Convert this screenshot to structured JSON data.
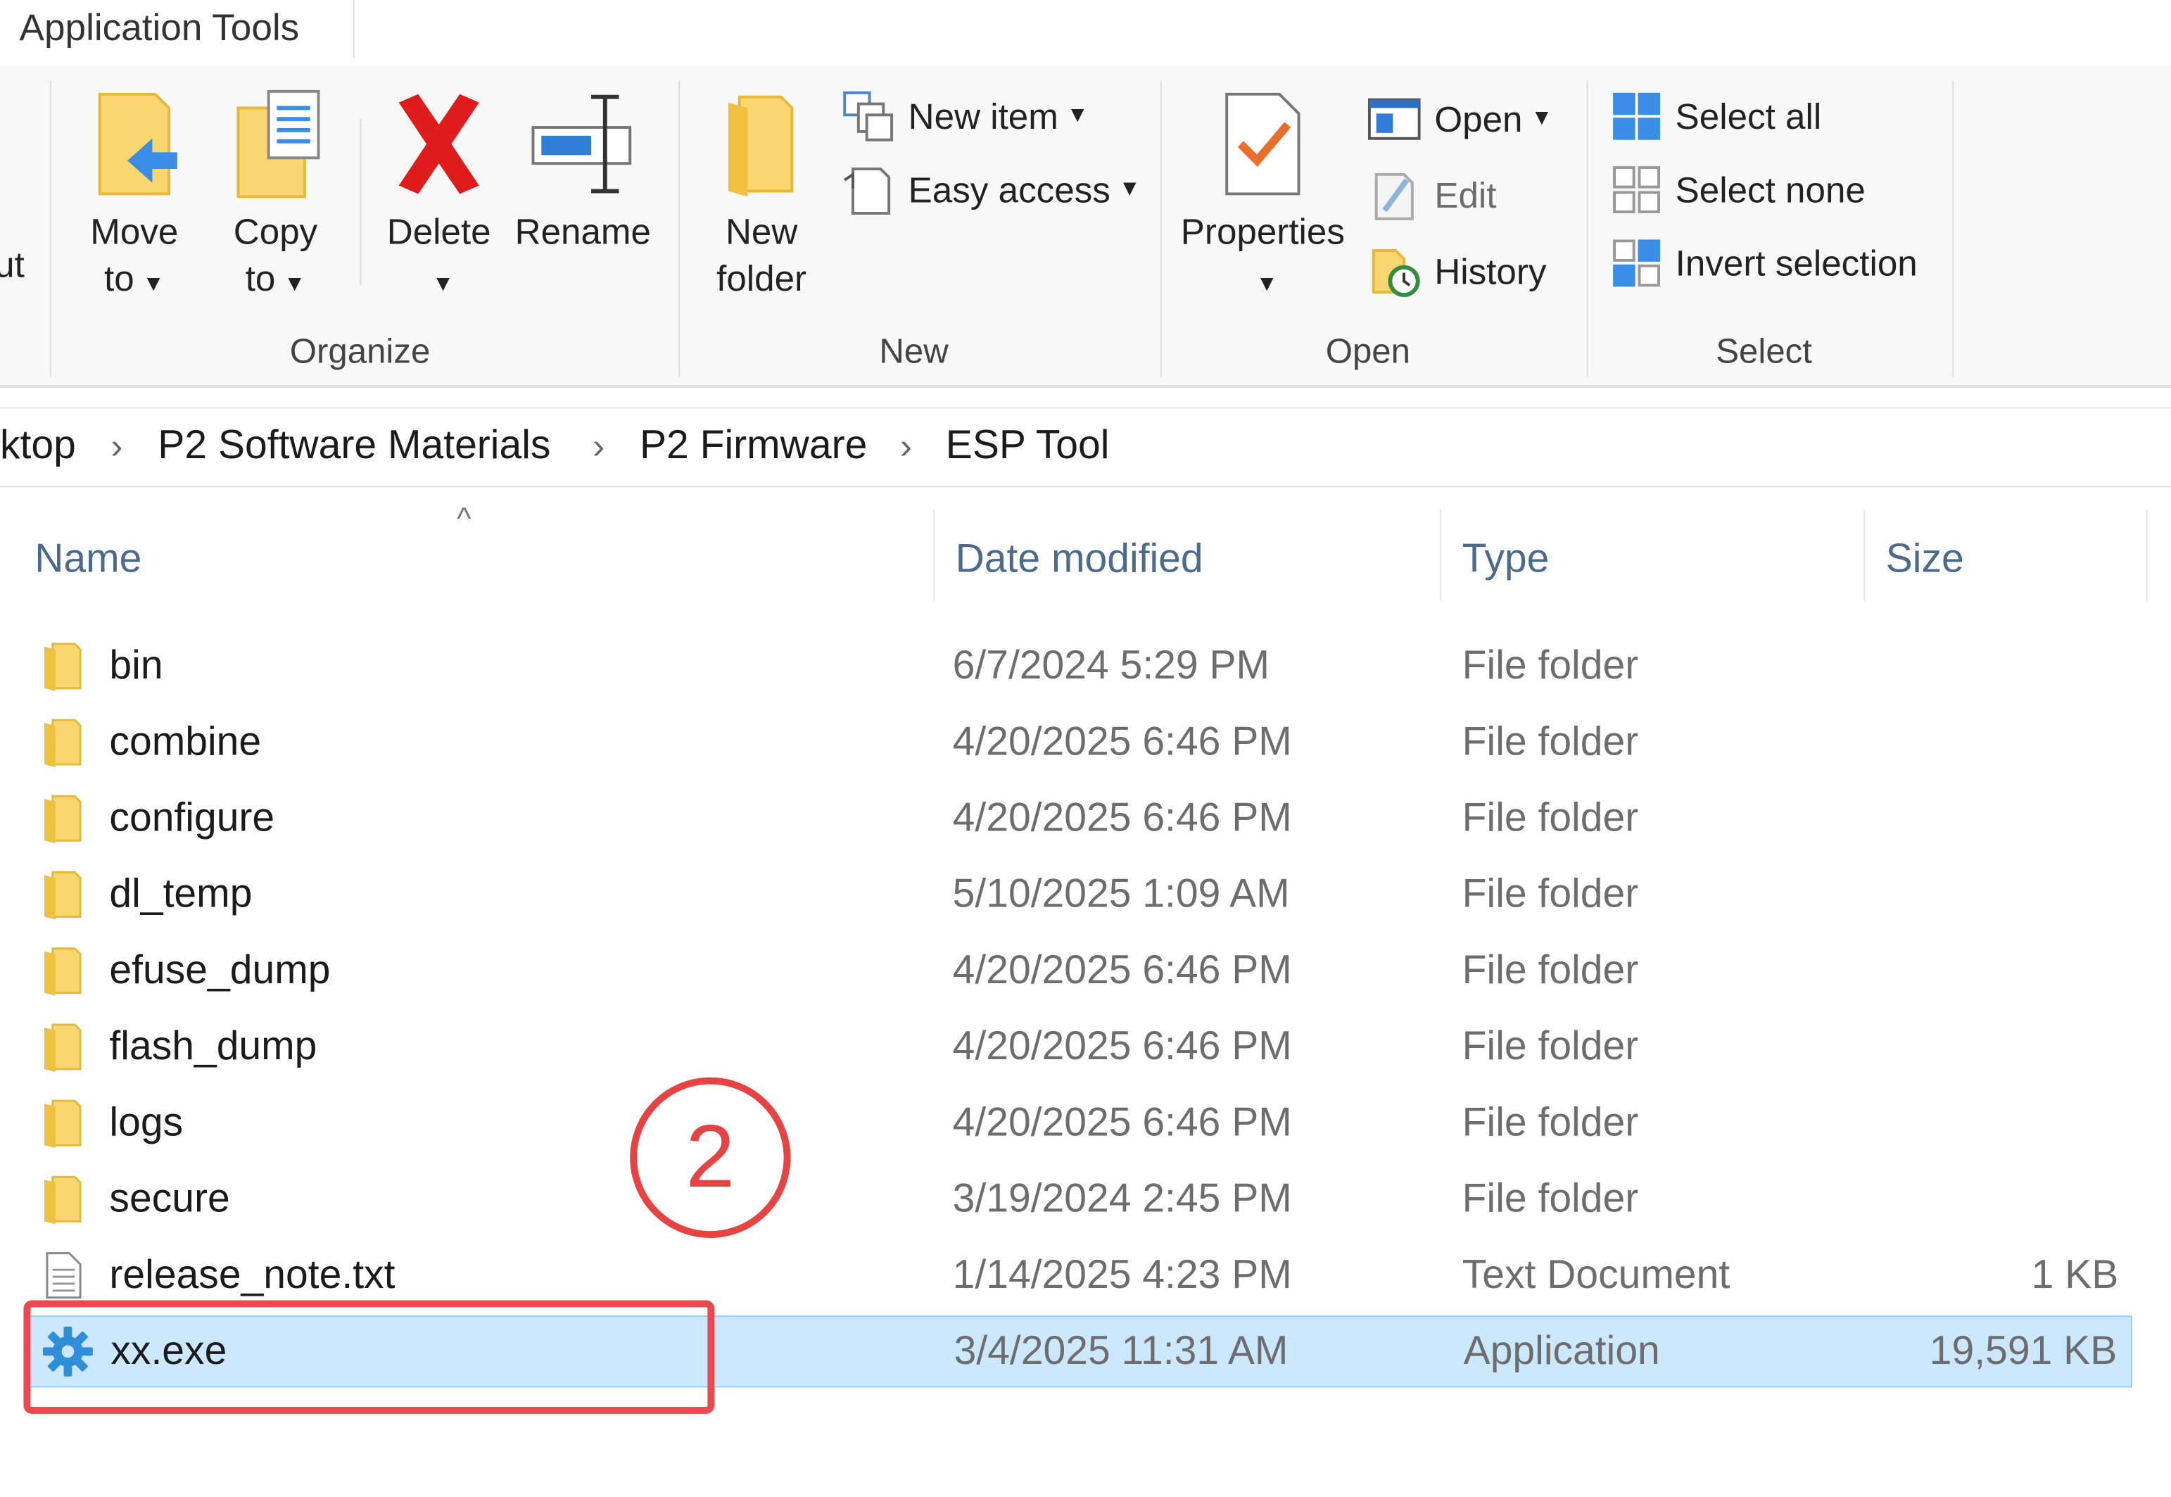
{
  "tab": {
    "title": "Application Tools"
  },
  "ribbon": {
    "clipped_left_label": "ut",
    "organize": {
      "label": "Organize",
      "move_to": [
        "Move",
        "to"
      ],
      "copy_to": [
        "Copy",
        "to"
      ],
      "delete": "Delete",
      "rename": "Rename"
    },
    "new": {
      "label": "New",
      "new_folder": [
        "New",
        "folder"
      ],
      "new_item": "New item",
      "easy_access": "Easy access"
    },
    "open": {
      "label": "Open",
      "properties": "Properties",
      "open": "Open",
      "edit": "Edit",
      "history": "History"
    },
    "select": {
      "label": "Select",
      "select_all": "Select all",
      "select_none": "Select none",
      "invert_selection": "Invert selection"
    }
  },
  "breadcrumb": [
    "ktop",
    "P2 Software Materials",
    "P2 Firmware",
    "ESP Tool"
  ],
  "columns": [
    "Name",
    "Date modified",
    "Type",
    "Size"
  ],
  "files": [
    {
      "name": "bin",
      "date": "6/7/2024 5:29 PM",
      "type": "File folder",
      "size": "",
      "icon": "folder-icon"
    },
    {
      "name": "combine",
      "date": "4/20/2025 6:46 PM",
      "type": "File folder",
      "size": "",
      "icon": "folder-icon"
    },
    {
      "name": "configure",
      "date": "4/20/2025 6:46 PM",
      "type": "File folder",
      "size": "",
      "icon": "folder-icon"
    },
    {
      "name": "dl_temp",
      "date": "5/10/2025 1:09 AM",
      "type": "File folder",
      "size": "",
      "icon": "folder-icon"
    },
    {
      "name": "efuse_dump",
      "date": "4/20/2025 6:46 PM",
      "type": "File folder",
      "size": "",
      "icon": "folder-icon"
    },
    {
      "name": "flash_dump",
      "date": "4/20/2025 6:46 PM",
      "type": "File folder",
      "size": "",
      "icon": "folder-icon"
    },
    {
      "name": "logs",
      "date": "4/20/2025 6:46 PM",
      "type": "File folder",
      "size": "",
      "icon": "folder-icon"
    },
    {
      "name": "secure",
      "date": "3/19/2024 2:45 PM",
      "type": "File folder",
      "size": "",
      "icon": "folder-icon"
    },
    {
      "name": "release_note.txt",
      "date": "1/14/2025 4:23 PM",
      "type": "Text Document",
      "size": "1 KB",
      "icon": "text-document-icon"
    },
    {
      "name": "xx.exe",
      "date": "3/4/2025 11:31 AM",
      "type": "Application",
      "size": "19,591 KB",
      "icon": "application-gear-icon",
      "selected": true
    }
  ],
  "annotation": {
    "step": "2",
    "color": "#e64343"
  },
  "colors": {
    "selection_bg": "#cce8ff",
    "selection_border": "#99d1ff",
    "header_text": "#4c6a8c",
    "folder": "#f8d775"
  }
}
